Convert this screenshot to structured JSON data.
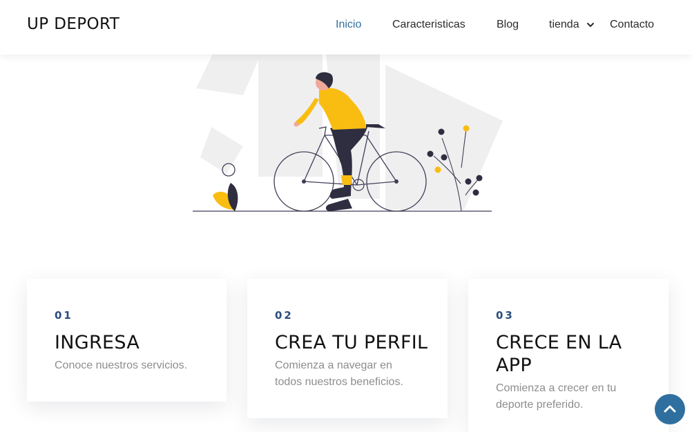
{
  "brand": "UP DEPORT",
  "nav": {
    "items": [
      {
        "label": "Inicio",
        "active": true
      },
      {
        "label": "Caracteristicas",
        "active": false
      },
      {
        "label": "Blog",
        "active": false
      },
      {
        "label": "tienda",
        "active": false,
        "dropdown": true
      },
      {
        "label": "Contacto",
        "active": false
      }
    ]
  },
  "colors": {
    "accent": "#2f6f9f",
    "illustration_yellow": "#f9bd12",
    "illustration_dark": "#2f2e41",
    "number_color": "#2a4d7e"
  },
  "cards": [
    {
      "num": "01",
      "title": "INGRESA",
      "desc": "Conoce nuestros servicios."
    },
    {
      "num": "02",
      "title": "CREA TU PERFIL",
      "desc": "Comienza a navegar en todos nuestros beneficios."
    },
    {
      "num": "03",
      "title": "CRECE EN LA APP",
      "desc": "Comienza a crecer en tu deporte preferido."
    }
  ],
  "icons": {
    "dropdown": "chevron-down-icon",
    "scroll_top": "chevron-up-icon",
    "hero": "cyclist-illustration"
  }
}
